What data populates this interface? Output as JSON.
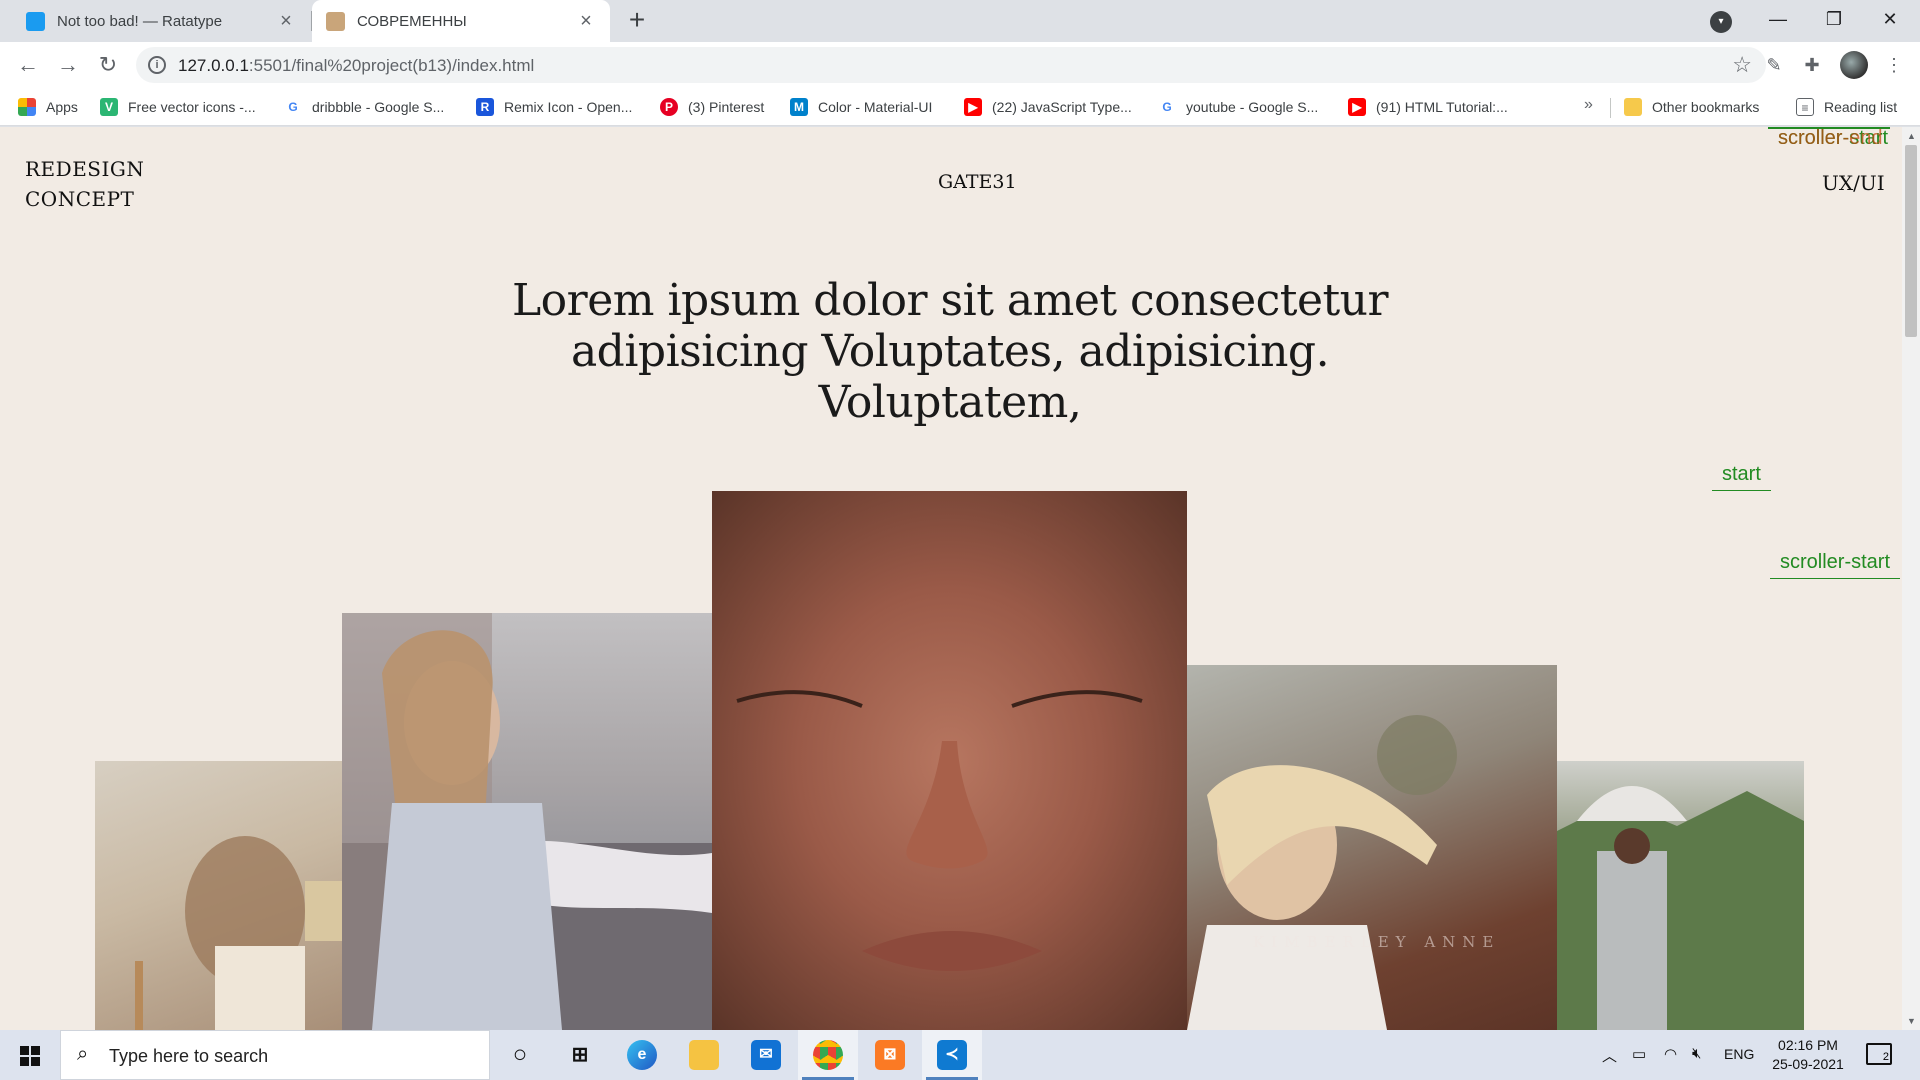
{
  "browser": {
    "tabs": [
      {
        "title": "Not too bad! — Ratatype",
        "favicon": "ratatype-icon",
        "color": "#1a9bf0"
      },
      {
        "title": "СОВРЕМЕННЫ",
        "favicon": "page-icon",
        "color": "#c9a57a"
      }
    ],
    "url_host": "127.0.0.1",
    "url_path": ":5501/final%20project(b13)/index.html",
    "bookmarks": [
      {
        "label": "Apps",
        "icon": "apps-grid-icon"
      },
      {
        "label": "Free vector icons -...",
        "icon": "vecteezy-icon"
      },
      {
        "label": "dribbble - Google S...",
        "icon": "google-icon"
      },
      {
        "label": "Remix Icon - Open...",
        "icon": "remix-icon"
      },
      {
        "label": "(3) Pinterest",
        "icon": "pinterest-icon"
      },
      {
        "label": "Color - Material-UI",
        "icon": "material-ui-icon"
      },
      {
        "label": "(22) JavaScript Type...",
        "icon": "youtube-icon"
      },
      {
        "label": "youtube - Google S...",
        "icon": "google-icon"
      },
      {
        "label": "(91) HTML Tutorial:...",
        "icon": "youtube-icon"
      }
    ],
    "bookmarks_more": "»",
    "other_bookmarks": "Other bookmarks",
    "reading_list": "Reading list"
  },
  "page": {
    "brand_line1": "REDESIGN",
    "brand_line2": "CONCEPT",
    "logo": "GATE31",
    "nav_right": "UX/UI",
    "headline": "Lorem ipsum dolor sit amet  consectetur adipisicing  Voluptates,  adipisicing. Voluptatem,",
    "markers": {
      "top_end": "scroller-end",
      "top_start": "scroller-start",
      "start": "start",
      "scroller_start": "scroller-start"
    },
    "photo4_caption": "KIMBERLEY ANNE"
  },
  "taskbar": {
    "search_placeholder": "Type here to search",
    "language": "ENG",
    "time": "02:16 PM",
    "date": "25-09-2021",
    "notification_count": "2"
  }
}
